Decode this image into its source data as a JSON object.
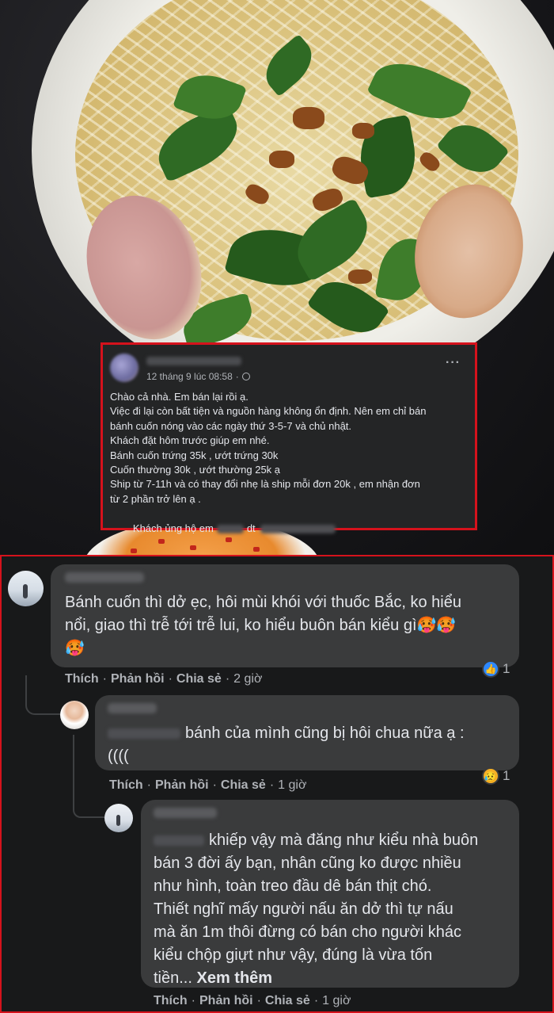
{
  "post": {
    "date": "12 tháng 9 lúc 08:58",
    "more_icon": "more-horizontal-icon",
    "privacy_icon": "globe-icon",
    "lines": [
      "Chào cả nhà. Em bán lại rồi ạ.",
      "Việc đi lại còn bất tiện và nguồn hàng không ổn định. Nên em chỉ bán",
      "bánh cuốn nóng vào các ngày thứ 3-5-7 và chủ nhật.",
      "Khách đặt hôm trước giúp em nhé.",
      "Bánh cuốn trứng 35k , ướt trứng 30k",
      "Cuốn thường 30k , ướt thường 25k ạ",
      "Ship từ 7-11h và có thay đổi nhẹ là ship mỗi đơn 20k , em nhận đơn",
      "từ 2 phần trở lên ạ ."
    ],
    "last_line_prefix": "Khách ủng hộ em",
    "last_line_mid": "dt"
  },
  "comments": [
    {
      "lines": [
        "Bánh cuốn thì dở ẹc, hôi mùi khói với thuốc Bắc, ko hiểu",
        "nổi, giao thì trễ tới trễ lui, ko hiểu buôn bán kiểu gì🥵🥵",
        "🥵"
      ],
      "reaction_count": "1",
      "reaction_icon": "like-icon",
      "actions": {
        "like": "Thích",
        "reply": "Phản hồi",
        "share": "Chia sẻ",
        "time": "2 giờ"
      }
    },
    {
      "lines": [
        "bánh của mình cũng bị hôi chua nữa ạ :",
        "(((("
      ],
      "reaction_count": "1",
      "reaction_icon": "sad-icon",
      "actions": {
        "like": "Thích",
        "reply": "Phản hồi",
        "share": "Chia sẻ",
        "time": "1 giờ"
      }
    },
    {
      "lines": [
        "khiếp vậy mà đăng như kiểu nhà buôn",
        "bán 3 đời ấy bạn, nhân cũng ko được nhiều",
        "như hình, toàn treo đầu dê bán thịt chó.",
        "Thiết nghĩ mấy người nấu ăn dở thì tự nấu",
        "mà ăn 1m thôi đừng có bán cho người khác",
        "kiểu chộp giựt như vậy, đúng là vừa tốn",
        "tiền..."
      ],
      "see_more": "Xem thêm",
      "actions": {
        "like": "Thích",
        "reply": "Phản hồi",
        "share": "Chia sẻ",
        "time": "1 giờ"
      }
    }
  ],
  "separator": "·",
  "colors": {
    "highlight_border": "#d5121c",
    "bubble": "#3a3b3c",
    "text": "#e4e6eb",
    "muted": "#b0b3b8",
    "like_blue": "#2d88ff"
  }
}
